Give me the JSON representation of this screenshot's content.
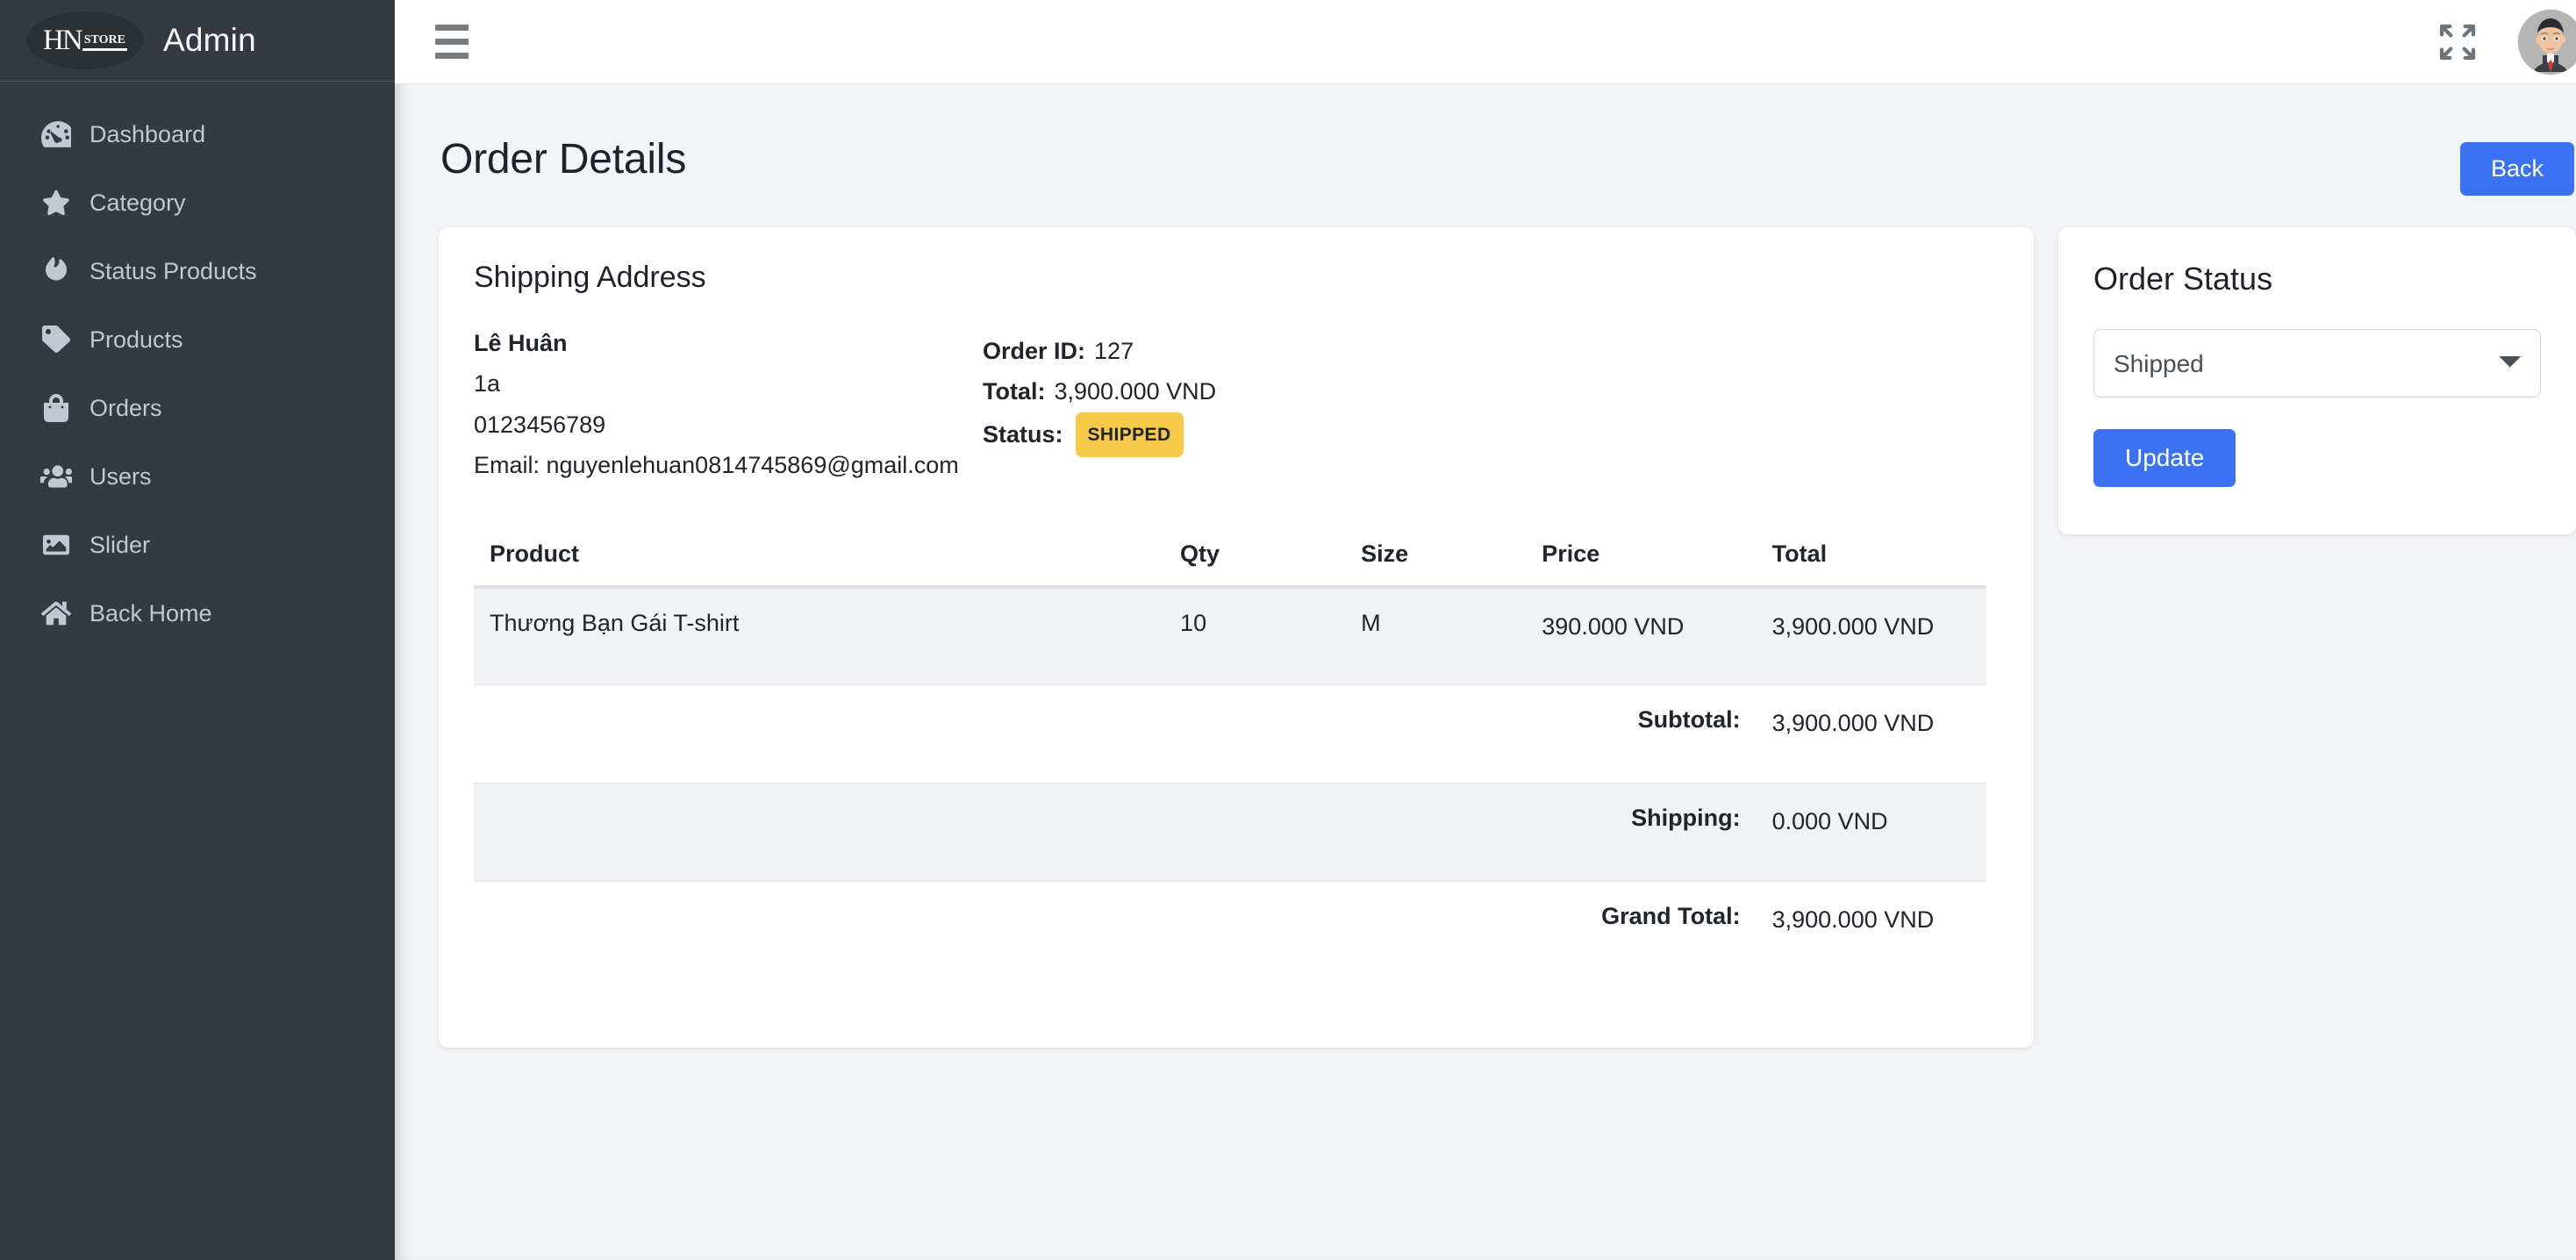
{
  "sidebar": {
    "brand": {
      "title": "Admin",
      "logo_primary": "HN",
      "logo_secondary": "STORE",
      "logo_icon": "hn-store-logo"
    },
    "items": [
      {
        "label": "Dashboard",
        "icon": "tachometer-icon"
      },
      {
        "label": "Category",
        "icon": "star-icon"
      },
      {
        "label": "Status Products",
        "icon": "fire-icon"
      },
      {
        "label": "Products",
        "icon": "tag-icon"
      },
      {
        "label": "Orders",
        "icon": "shopping-bag-icon"
      },
      {
        "label": "Users",
        "icon": "users-icon"
      },
      {
        "label": "Slider",
        "icon": "image-icon"
      },
      {
        "label": "Back Home",
        "icon": "home-icon"
      }
    ]
  },
  "topbar": {
    "menu_toggle_icon": "hamburger-icon",
    "fullscreen_icon": "expand-arrows-icon",
    "avatar_icon": "user-avatar"
  },
  "page": {
    "title": "Order Details",
    "back_label": "Back"
  },
  "shipping": {
    "heading": "Shipping Address",
    "name": "Lê Huân",
    "address": "1a",
    "phone": "0123456789",
    "email": "Email: nguyenlehuan0814745869@gmail.com"
  },
  "order_meta": {
    "order_id_label": "Order ID:",
    "order_id_value": "127",
    "total_label": "Total:",
    "total_value": "3,900.000 VND",
    "status_label": "Status:",
    "status_value": "SHIPPED",
    "status_color": "#f7c948"
  },
  "items_table": {
    "columns": [
      "Product",
      "Qty",
      "Size",
      "Price",
      "Total"
    ],
    "rows": [
      {
        "product": "Thương Bạn Gái T-shirt",
        "qty": "10",
        "size": "M",
        "price": "390.000 VND",
        "total": "3,900.000 VND"
      }
    ],
    "summary": [
      {
        "label": "Subtotal:",
        "value": "3,900.000 VND"
      },
      {
        "label": "Shipping:",
        "value": "0.000 VND"
      },
      {
        "label": "Grand Total:",
        "value": "3,900.000 VND"
      }
    ]
  },
  "order_status_panel": {
    "title": "Order Status",
    "selected": "Shipped",
    "options": [
      "Shipped"
    ],
    "update_label": "Update",
    "accent_color": "#3b71f3"
  }
}
